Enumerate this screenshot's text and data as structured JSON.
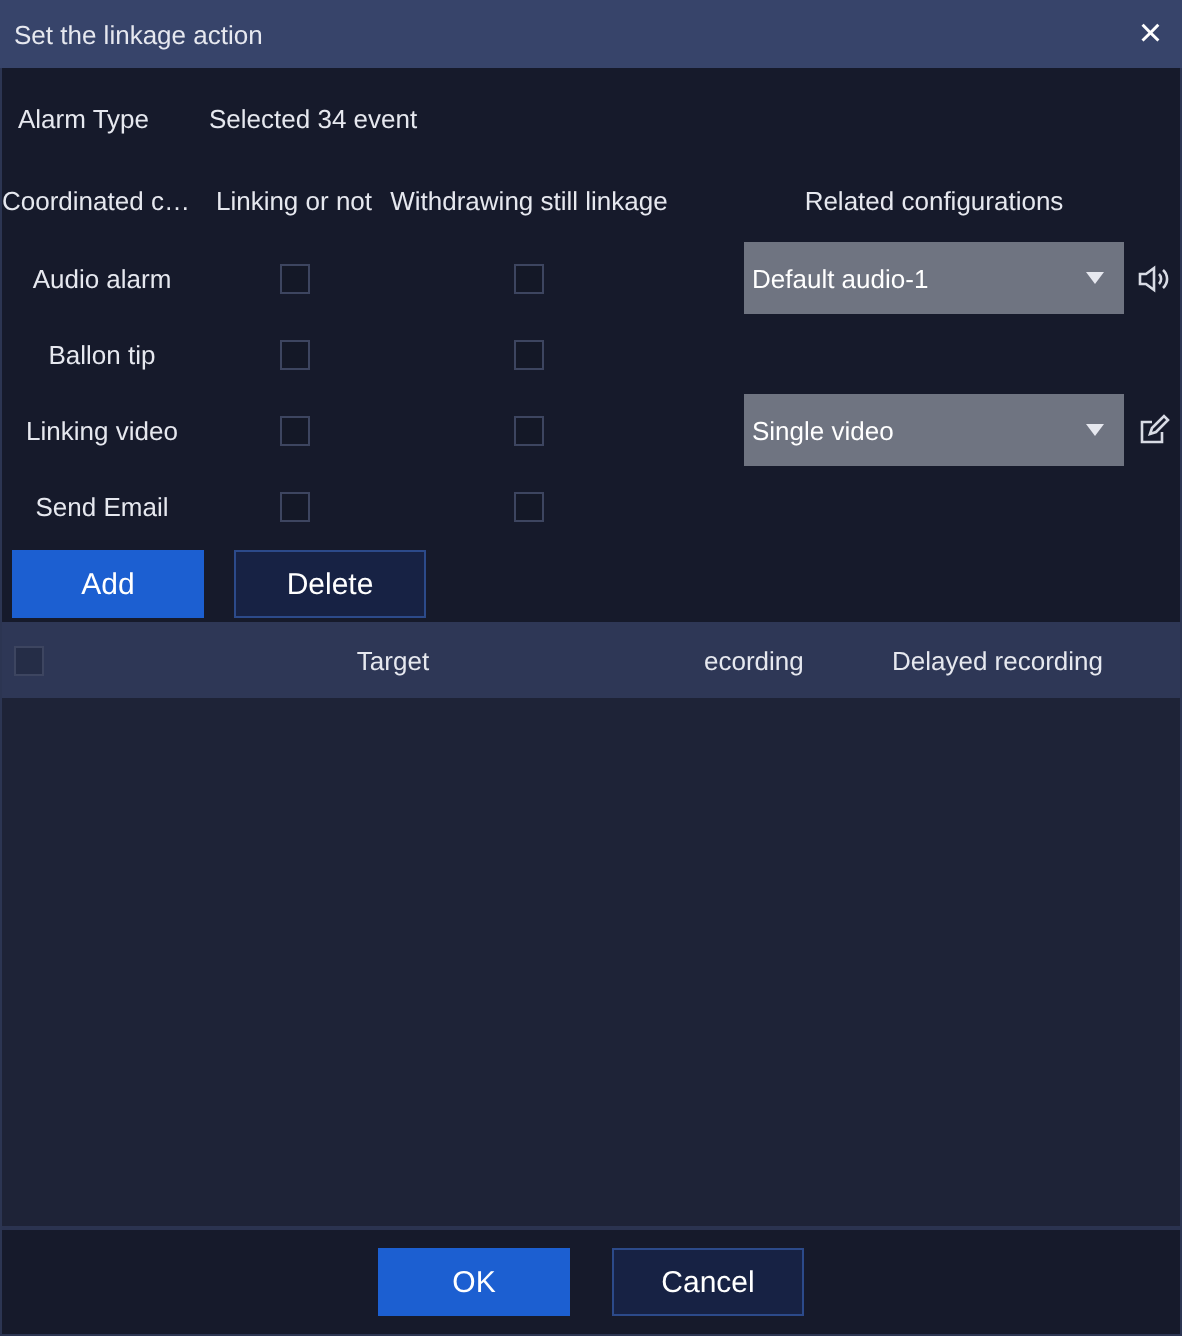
{
  "window": {
    "title": "Set the linkage action",
    "close": "×"
  },
  "alarm_type": {
    "label": "Alarm Type",
    "value": "Selected 34 event"
  },
  "columns": [
    "Coordinated c…",
    "Linking or not",
    "Withdrawing still linkage",
    "Related configurations"
  ],
  "actions": [
    {
      "name": "Audio alarm",
      "linking": false,
      "withdrawing": false,
      "config": {
        "value": "Default audio-1",
        "kind": "audio"
      }
    },
    {
      "name": "Ballon tip",
      "linking": false,
      "withdrawing": false
    },
    {
      "name": "Linking video",
      "linking": false,
      "withdrawing": false,
      "config": {
        "value": "Single video",
        "kind": "video"
      }
    },
    {
      "name": "Send Email",
      "linking": false,
      "withdrawing": false
    }
  ],
  "buttons": [
    {
      "label": "Add",
      "kind": "primary"
    },
    {
      "label": "Delete",
      "kind": "secondary"
    }
  ],
  "table": {
    "select_all": false,
    "columns": [
      "Target",
      "ecording",
      "Delayed recording"
    ]
  },
  "footer_buttons": [
    {
      "label": "OK",
      "kind": "primary"
    },
    {
      "label": "Cancel",
      "kind": "secondary"
    }
  ]
}
